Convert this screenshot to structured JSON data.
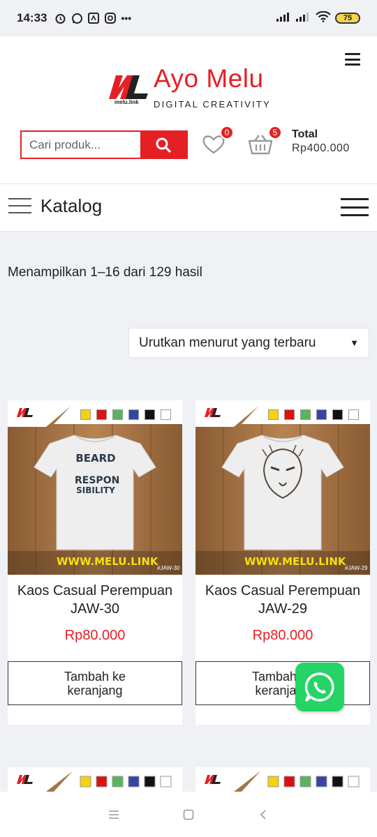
{
  "status": {
    "time": "14:33",
    "battery": "75",
    "more": "•••"
  },
  "header": {
    "brand_title": "Ayo Melu",
    "brand_sub": "DIGITAL CREATIVITY",
    "logo_tag": "melu.link",
    "search_placeholder": "Cari produk...",
    "wishlist_count": "0",
    "cart_count": "5",
    "total_label": "Total",
    "total_value": "Rp400.000"
  },
  "catalog": {
    "title": "Katalog",
    "results": "Menampilkan 1–16 dari 129 hasil",
    "sort_label": "Urutkan menurut yang terbaru"
  },
  "products": [
    {
      "name": "Kaos Casual Perempuan JAW-30",
      "price": "Rp80.000",
      "button": "Tambah ke keranjang",
      "image_url_text": "WWW.MELU.LINK",
      "image_code": "#JAW-30",
      "shirt_text": [
        "BEARD",
        "RESPON",
        "SIBILITY"
      ]
    },
    {
      "name": "Kaos Casual Perempuan JAW-29",
      "price": "Rp80.000",
      "button": "Tambah ke keranjang",
      "image_url_text": "WWW.MELU.LINK",
      "image_code": "#JAW-29",
      "shirt_text": []
    }
  ],
  "swatch_colors": [
    "#f5d20a",
    "#e01010",
    "#5bb35b",
    "#3645a5",
    "#111111",
    "#ffffff"
  ],
  "colors": {
    "brand_red": "#e42025",
    "whatsapp": "#25d366"
  },
  "icons": {
    "hamburger": "hamburger-icon",
    "search": "search-icon",
    "heart": "heart-icon",
    "cart": "cart-icon",
    "whatsapp": "whatsapp-icon"
  }
}
